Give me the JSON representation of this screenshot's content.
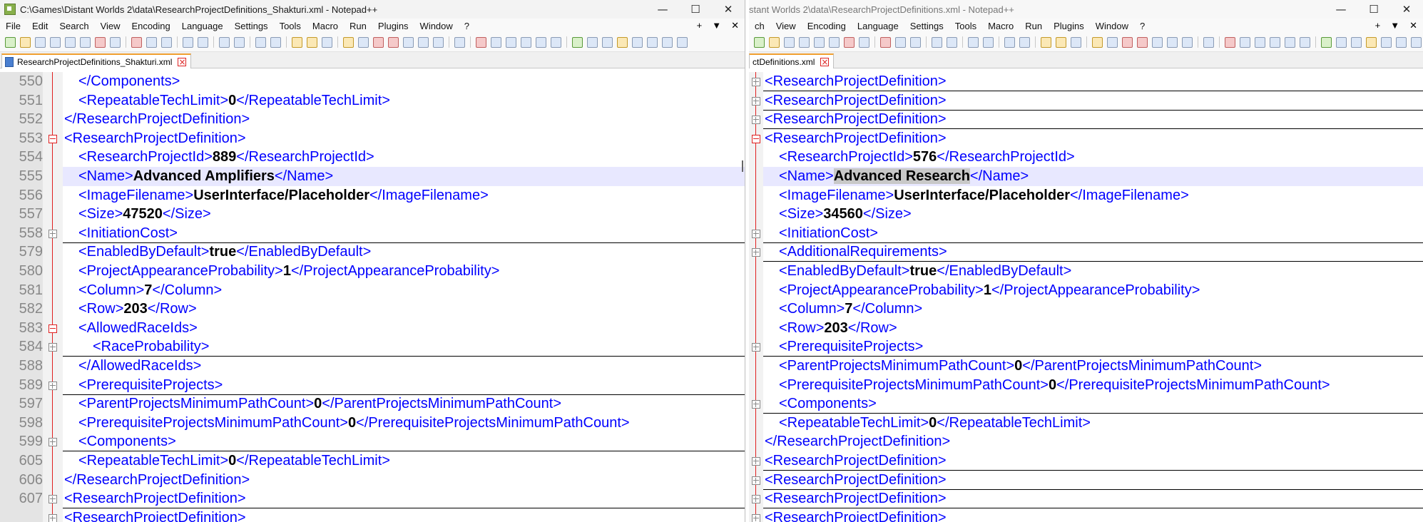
{
  "left": {
    "title": "C:\\Games\\Distant Worlds 2\\data\\ResearchProjectDefinitions_Shakturi.xml - Notepad++",
    "tab_label": "ResearchProjectDefinitions_Shakturi.xml",
    "menus": [
      "File",
      "Edit",
      "Search",
      "View",
      "Encoding",
      "Language",
      "Settings",
      "Tools",
      "Macro",
      "Run",
      "Plugins",
      "Window",
      "?"
    ],
    "lines": [
      {
        "n": "550",
        "indent": 2,
        "fold": "line",
        "parts": [
          {
            "t": "</Components>",
            "k": "tag"
          }
        ]
      },
      {
        "n": "551",
        "indent": 2,
        "fold": "line",
        "parts": [
          {
            "t": "<RepeatableTechLimit>",
            "k": "tag"
          },
          {
            "t": "0",
            "k": "val"
          },
          {
            "t": "</RepeatableTechLimit>",
            "k": "tag"
          }
        ]
      },
      {
        "n": "552",
        "indent": 1,
        "fold": "line",
        "parts": [
          {
            "t": "</ResearchProjectDefinition>",
            "k": "tag"
          }
        ]
      },
      {
        "n": "553",
        "indent": 1,
        "fold": "minus",
        "parts": [
          {
            "t": "<ResearchProjectDefinition>",
            "k": "tag"
          }
        ]
      },
      {
        "n": "554",
        "indent": 2,
        "fold": "line",
        "parts": [
          {
            "t": "<ResearchProjectId>",
            "k": "tag"
          },
          {
            "t": "889",
            "k": "val"
          },
          {
            "t": "</ResearchProjectId>",
            "k": "tag"
          }
        ]
      },
      {
        "n": "555",
        "indent": 2,
        "fold": "line",
        "hl": true,
        "parts": [
          {
            "t": "<Name>",
            "k": "tag"
          },
          {
            "t": "Advanced Amplifiers",
            "k": "val"
          },
          {
            "t": "</Name>",
            "k": "tag"
          }
        ]
      },
      {
        "n": "556",
        "indent": 2,
        "fold": "line",
        "parts": [
          {
            "t": "<ImageFilename>",
            "k": "tag"
          },
          {
            "t": "UserInterface/Placeholder",
            "k": "val"
          },
          {
            "t": "</ImageFilename>",
            "k": "tag"
          }
        ]
      },
      {
        "n": "557",
        "indent": 2,
        "fold": "line",
        "parts": [
          {
            "t": "<Size>",
            "k": "tag"
          },
          {
            "t": "47520",
            "k": "val"
          },
          {
            "t": "</Size>",
            "k": "tag"
          }
        ]
      },
      {
        "n": "558",
        "indent": 2,
        "fold": "plus",
        "parts": [
          {
            "t": "<InitiationCost>",
            "k": "tag"
          }
        ]
      },
      {
        "n": "579",
        "indent": 2,
        "fold": "line",
        "parts": [
          {
            "t": "<EnabledByDefault>",
            "k": "tag"
          },
          {
            "t": "true",
            "k": "val"
          },
          {
            "t": "</EnabledByDefault>",
            "k": "tag"
          }
        ]
      },
      {
        "n": "580",
        "indent": 2,
        "fold": "line",
        "parts": [
          {
            "t": "<ProjectAppearanceProbability>",
            "k": "tag"
          },
          {
            "t": "1",
            "k": "val"
          },
          {
            "t": "</ProjectAppearanceProbability>",
            "k": "tag"
          }
        ]
      },
      {
        "n": "581",
        "indent": 2,
        "fold": "line",
        "parts": [
          {
            "t": "<Column>",
            "k": "tag"
          },
          {
            "t": "7",
            "k": "val"
          },
          {
            "t": "</Column>",
            "k": "tag"
          }
        ]
      },
      {
        "n": "582",
        "indent": 2,
        "fold": "line",
        "parts": [
          {
            "t": "<Row>",
            "k": "tag"
          },
          {
            "t": "203",
            "k": "val"
          },
          {
            "t": "</Row>",
            "k": "tag"
          }
        ]
      },
      {
        "n": "583",
        "indent": 2,
        "fold": "minus",
        "parts": [
          {
            "t": "<AllowedRaceIds>",
            "k": "tag"
          }
        ]
      },
      {
        "n": "584",
        "indent": 3,
        "fold": "plus",
        "parts": [
          {
            "t": "<RaceProbability>",
            "k": "tag"
          }
        ]
      },
      {
        "n": "588",
        "indent": 2,
        "fold": "line",
        "parts": [
          {
            "t": "</AllowedRaceIds>",
            "k": "tag"
          }
        ]
      },
      {
        "n": "589",
        "indent": 2,
        "fold": "plus",
        "parts": [
          {
            "t": "<PrerequisiteProjects>",
            "k": "tag"
          }
        ]
      },
      {
        "n": "597",
        "indent": 2,
        "fold": "line",
        "parts": [
          {
            "t": "<ParentProjectsMinimumPathCount>",
            "k": "tag"
          },
          {
            "t": "0",
            "k": "val"
          },
          {
            "t": "</ParentProjectsMinimumPathCount>",
            "k": "tag"
          }
        ]
      },
      {
        "n": "598",
        "indent": 2,
        "fold": "line",
        "parts": [
          {
            "t": "<PrerequisiteProjectsMinimumPathCount>",
            "k": "tag"
          },
          {
            "t": "0",
            "k": "val"
          },
          {
            "t": "</PrerequisiteProjectsMinimumPathCount>",
            "k": "tag"
          }
        ]
      },
      {
        "n": "599",
        "indent": 2,
        "fold": "plus",
        "parts": [
          {
            "t": "<Components>",
            "k": "tag"
          }
        ]
      },
      {
        "n": "605",
        "indent": 2,
        "fold": "line",
        "parts": [
          {
            "t": "<RepeatableTechLimit>",
            "k": "tag"
          },
          {
            "t": "0",
            "k": "val"
          },
          {
            "t": "</RepeatableTechLimit>",
            "k": "tag"
          }
        ]
      },
      {
        "n": "606",
        "indent": 1,
        "fold": "line",
        "parts": [
          {
            "t": "</ResearchProjectDefinition>",
            "k": "tag"
          }
        ]
      },
      {
        "n": "607",
        "indent": 1,
        "fold": "plus",
        "parts": [
          {
            "t": "<ResearchProjectDefinition>",
            "k": "tag"
          }
        ]
      },
      {
        "n": "",
        "indent": 1,
        "fold": "plus",
        "parts": [
          {
            "t": "<ResearchProjectDefinition>",
            "k": "tag"
          }
        ]
      }
    ]
  },
  "right": {
    "title": "stant Worlds 2\\data\\ResearchProjectDefinitions.xml - Notepad++",
    "tab_label": "ctDefinitions.xml",
    "menus": [
      "ch",
      "View",
      "Encoding",
      "Language",
      "Settings",
      "Tools",
      "Macro",
      "Run",
      "Plugins",
      "Window",
      "?"
    ],
    "lines": [
      {
        "indent": 1,
        "fold": "plus",
        "parts": [
          {
            "t": "<ResearchProjectDefinition>",
            "k": "tag"
          }
        ]
      },
      {
        "indent": 1,
        "fold": "plus",
        "parts": [
          {
            "t": "<ResearchProjectDefinition>",
            "k": "tag"
          }
        ]
      },
      {
        "indent": 1,
        "fold": "plus",
        "parts": [
          {
            "t": "<ResearchProjectDefinition>",
            "k": "tag"
          }
        ]
      },
      {
        "indent": 1,
        "fold": "minus",
        "parts": [
          {
            "t": "<ResearchProjectDefinition>",
            "k": "tag"
          }
        ]
      },
      {
        "indent": 2,
        "fold": "line",
        "parts": [
          {
            "t": "<ResearchProjectId>",
            "k": "tag"
          },
          {
            "t": "576",
            "k": "val"
          },
          {
            "t": "</ResearchProjectId>",
            "k": "tag"
          }
        ]
      },
      {
        "indent": 2,
        "fold": "line",
        "hl": true,
        "parts": [
          {
            "t": "<Name>",
            "k": "tag"
          },
          {
            "t": "Advanced Research",
            "k": "sel"
          },
          {
            "t": "</Name>",
            "k": "tag"
          }
        ]
      },
      {
        "indent": 2,
        "fold": "line",
        "parts": [
          {
            "t": "<ImageFilename>",
            "k": "tag"
          },
          {
            "t": "UserInterface/Placeholder",
            "k": "val"
          },
          {
            "t": "</ImageFilename>",
            "k": "tag"
          }
        ]
      },
      {
        "indent": 2,
        "fold": "line",
        "parts": [
          {
            "t": "<Size>",
            "k": "tag"
          },
          {
            "t": "34560",
            "k": "val"
          },
          {
            "t": "</Size>",
            "k": "tag"
          }
        ]
      },
      {
        "indent": 2,
        "fold": "plus",
        "parts": [
          {
            "t": "<InitiationCost>",
            "k": "tag"
          }
        ]
      },
      {
        "indent": 2,
        "fold": "plus",
        "parts": [
          {
            "t": "<AdditionalRequirements>",
            "k": "tag"
          }
        ]
      },
      {
        "indent": 2,
        "fold": "line",
        "parts": [
          {
            "t": "<EnabledByDefault>",
            "k": "tag"
          },
          {
            "t": "true",
            "k": "val"
          },
          {
            "t": "</EnabledByDefault>",
            "k": "tag"
          }
        ]
      },
      {
        "indent": 2,
        "fold": "line",
        "parts": [
          {
            "t": "<ProjectAppearanceProbability>",
            "k": "tag"
          },
          {
            "t": "1",
            "k": "val"
          },
          {
            "t": "</ProjectAppearanceProbability>",
            "k": "tag"
          }
        ]
      },
      {
        "indent": 2,
        "fold": "line",
        "parts": [
          {
            "t": "<Column>",
            "k": "tag"
          },
          {
            "t": "7",
            "k": "val"
          },
          {
            "t": "</Column>",
            "k": "tag"
          }
        ]
      },
      {
        "indent": 2,
        "fold": "line",
        "parts": [
          {
            "t": "<Row>",
            "k": "tag"
          },
          {
            "t": "203",
            "k": "val"
          },
          {
            "t": "</Row>",
            "k": "tag"
          }
        ]
      },
      {
        "indent": 2,
        "fold": "plus",
        "parts": [
          {
            "t": "<PrerequisiteProjects>",
            "k": "tag"
          }
        ]
      },
      {
        "indent": 2,
        "fold": "line",
        "parts": [
          {
            "t": "<ParentProjectsMinimumPathCount>",
            "k": "tag"
          },
          {
            "t": "0",
            "k": "val"
          },
          {
            "t": "</ParentProjectsMinimumPathCount>",
            "k": "tag"
          }
        ]
      },
      {
        "indent": 2,
        "fold": "line",
        "parts": [
          {
            "t": "<PrerequisiteProjectsMinimumPathCount>",
            "k": "tag"
          },
          {
            "t": "0",
            "k": "val"
          },
          {
            "t": "</PrerequisiteProjectsMinimumPathCount>",
            "k": "tag"
          }
        ]
      },
      {
        "indent": 2,
        "fold": "plus",
        "parts": [
          {
            "t": "<Components>",
            "k": "tag"
          }
        ]
      },
      {
        "indent": 2,
        "fold": "line",
        "parts": [
          {
            "t": "<RepeatableTechLimit>",
            "k": "tag"
          },
          {
            "t": "0",
            "k": "val"
          },
          {
            "t": "</RepeatableTechLimit>",
            "k": "tag"
          }
        ]
      },
      {
        "indent": 1,
        "fold": "line",
        "parts": [
          {
            "t": "</ResearchProjectDefinition>",
            "k": "tag"
          }
        ]
      },
      {
        "indent": 1,
        "fold": "plus",
        "parts": [
          {
            "t": "<ResearchProjectDefinition>",
            "k": "tag"
          }
        ]
      },
      {
        "indent": 1,
        "fold": "plus",
        "parts": [
          {
            "t": "<ResearchProjectDefinition>",
            "k": "tag"
          }
        ]
      },
      {
        "indent": 1,
        "fold": "plus",
        "parts": [
          {
            "t": "<ResearchProjectDefinition>",
            "k": "tag"
          }
        ]
      },
      {
        "indent": 1,
        "fold": "plus",
        "parts": [
          {
            "t": "<ResearchProjectDefinition>",
            "k": "tag"
          }
        ]
      }
    ]
  },
  "window_controls": {
    "minimize": "—",
    "maximize": "☐",
    "close": "✕"
  },
  "menu_right": {
    "plus": "+",
    "dropdown": "▼",
    "close": "✕"
  },
  "colors": {
    "tag": "#0000ff",
    "value": "#000000",
    "fold_marker": "#e02020",
    "current_line": "#e8e8ff"
  }
}
